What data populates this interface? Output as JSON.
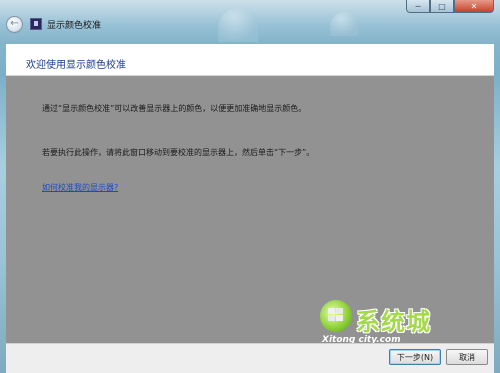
{
  "window": {
    "title": "显示颜色校准",
    "back_glyph": "←",
    "minimize_glyph": "─",
    "maximize_glyph": "□",
    "close_glyph": "✕"
  },
  "header": {
    "title": "欢迎使用显示颜色校准"
  },
  "body": {
    "intro": "通过“显示颜色校准”可以改善显示器上的颜色，以便更加准确地显示颜色。",
    "instruction": "若要执行此操作，请将此窗口移动到要校准的显示器上，然后单击“下一步”。",
    "help_link": "如何校准我的显示器?"
  },
  "footer": {
    "next_label": "下一步(N)",
    "cancel_label": "取消"
  },
  "watermark": {
    "brand": "系统城",
    "url": "Xitong city.com"
  },
  "colors": {
    "content_bg": "#929292",
    "header_title": "#1a3a8a",
    "link": "#1c4cc2",
    "accent_button": "#3c7fb1"
  }
}
